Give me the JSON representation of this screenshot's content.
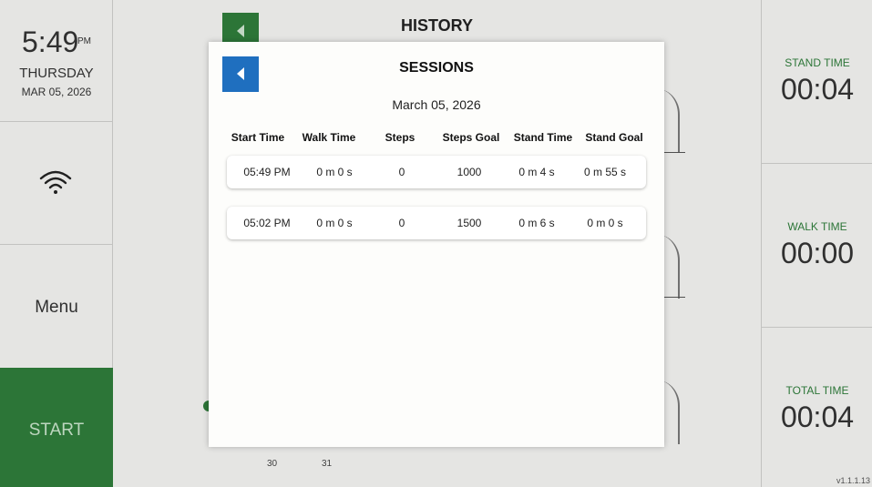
{
  "sidebar": {
    "time": "5:49",
    "ampm": "PM",
    "day": "THURSDAY",
    "date": "MAR 05, 2026",
    "wifi_icon": "wifi-icon",
    "menu_label": "Menu",
    "start_label": "START"
  },
  "background": {
    "title": "HISTORY",
    "x_ticks": [
      "30",
      "31"
    ]
  },
  "stats": [
    {
      "label": "STAND TIME",
      "value": "00:04"
    },
    {
      "label": "WALK TIME",
      "value": "00:00"
    },
    {
      "label": "TOTAL TIME",
      "value": "00:04"
    }
  ],
  "version": "v1.1.1.13",
  "modal": {
    "back_icon": "chevron-left-icon",
    "title": "SESSIONS",
    "date": "March 05, 2026",
    "columns": [
      "Start Time",
      "Walk Time",
      "Steps",
      "Steps Goal",
      "Stand Time",
      "Stand Goal"
    ],
    "rows": [
      [
        "05:49 PM",
        "0 m 0 s",
        "0",
        "1000",
        "0 m 4 s",
        "0 m 55 s"
      ],
      [
        "05:02 PM",
        "0 m 0 s",
        "0",
        "1500",
        "0 m 6 s",
        "0 m 0 s"
      ]
    ]
  },
  "colors": {
    "accent_green": "#2f7d3b",
    "modal_button_blue": "#1f6fbf"
  }
}
